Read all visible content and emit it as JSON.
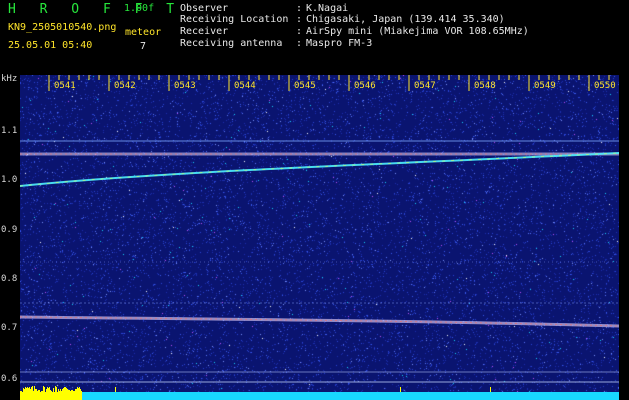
{
  "header": {
    "brand": "H R O F F T",
    "version": "1.00f",
    "filename": "KN9_2505010540.png",
    "timestamp": "25.05.01 05:40",
    "meteor_label": "meteor",
    "meteor_count": "7"
  },
  "info": {
    "rows": [
      {
        "label": "Observer",
        "value": "K.Nagai"
      },
      {
        "label": "Receiving Location",
        "value": "Chigasaki, Japan (139.414 35.340)"
      },
      {
        "label": "Receiver",
        "value": "AirSpy mini (Miakejima VOR 108.65MHz)"
      },
      {
        "label": "Receiving antenna",
        "value": "Maspro FM-3"
      }
    ]
  },
  "axis": {
    "y_unit": "kHz",
    "y_ticks": [
      "1.1",
      "1.0",
      "0.9",
      "0.8",
      "0.7",
      "0.6"
    ],
    "x_ticks": [
      "0541",
      "0542",
      "0543",
      "0544",
      "0545",
      "0546",
      "0547",
      "0548",
      "0549",
      "0550"
    ]
  },
  "colors": {
    "background": "#0a1470",
    "header_text": "#27e63c",
    "tick_text": "#ffe52a",
    "carrier": "#38d0ff",
    "meteor_bar": "#ffff00",
    "meteor_count_bar": "#18d8ff"
  }
}
